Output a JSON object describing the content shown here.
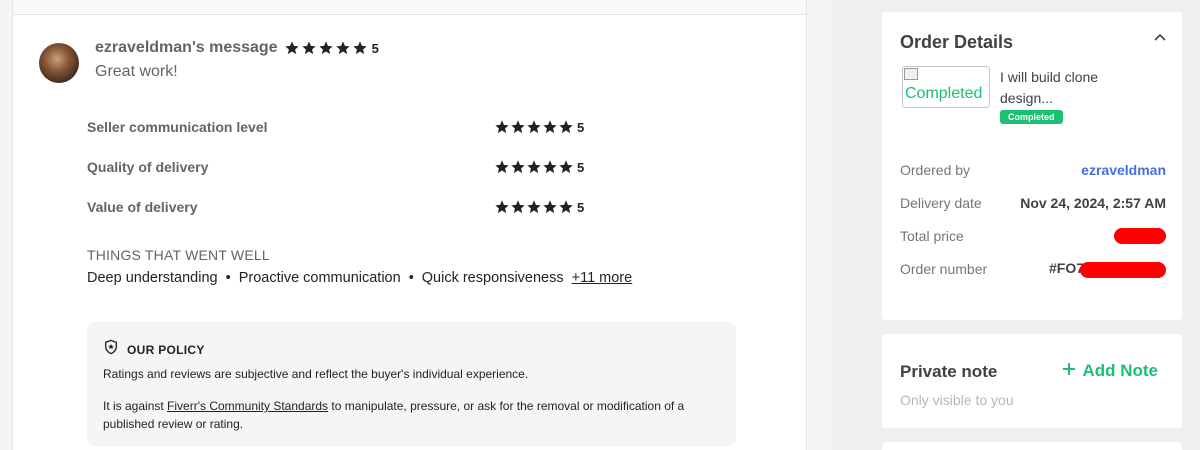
{
  "review": {
    "author": "ezraveldman's message",
    "rating": "5",
    "message": "Great work!",
    "criteria": [
      {
        "label": "Seller communication level",
        "score": "5"
      },
      {
        "label": "Quality of delivery",
        "score": "5"
      },
      {
        "label": "Value of delivery",
        "score": "5"
      }
    ],
    "went_well_title": "THINGS THAT WENT WELL",
    "went_well": [
      "Deep understanding",
      "Proactive communication",
      "Quick responsiveness"
    ],
    "separator": "•",
    "more_label": "+11 more"
  },
  "policy": {
    "title": "OUR POLICY",
    "line1": "Ratings and reviews are subjective and reflect the buyer's individual experience.",
    "line2_pre": "It is against ",
    "line2_link": "Fiverr's Community Standards",
    "line2_post": " to manipulate, pressure, or ask for the removal or modification of a published review or rating."
  },
  "order": {
    "title": "Order Details",
    "thumb_alt": "Completed",
    "gig_title": "I will build clone design...",
    "status": "Completed",
    "ordered_by_label": "Ordered by",
    "ordered_by": "ezraveldman",
    "delivery_label": "Delivery date",
    "delivery_date": "Nov 24, 2024, 2:57 AM",
    "price_label": "Total price",
    "number_label": "Order number",
    "number_prefix": "#FO7"
  },
  "note": {
    "title": "Private note",
    "add_label": "Add Note",
    "subtitle": "Only visible to you"
  },
  "colors": {
    "accent": "#1dbf73",
    "link": "#446ee7",
    "redaction": "#ff0000"
  }
}
